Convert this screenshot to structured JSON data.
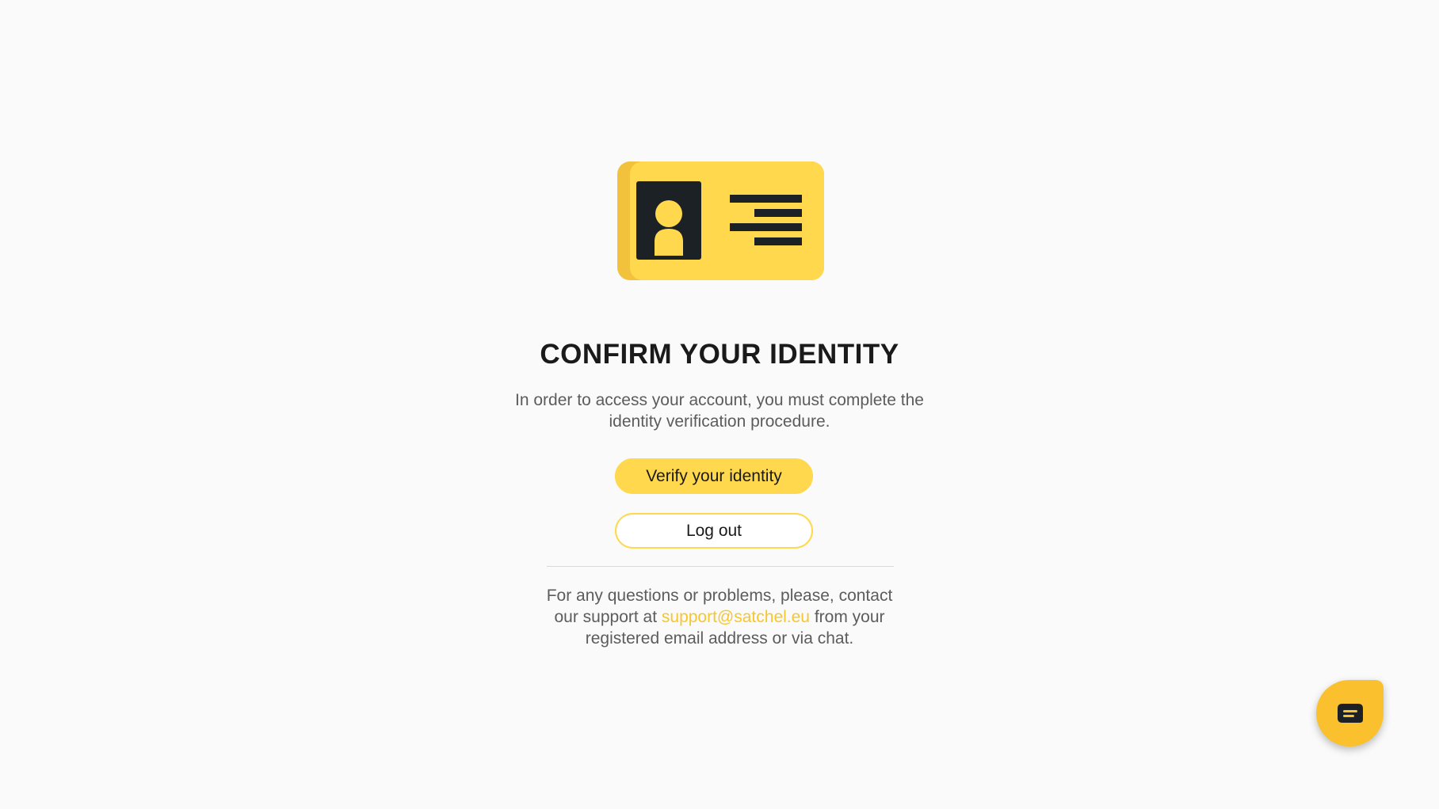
{
  "illustration": {
    "icon": "id-card-icon",
    "colors": {
      "card": "#ffd84d",
      "card_edge": "#f2c23c",
      "dark": "#1b2125"
    }
  },
  "main": {
    "title": "CONFIRM YOUR IDENTITY",
    "description": "In order to access your account, you must complete the identity verification procedure.",
    "verify_button_label": "Verify your identity",
    "logout_button_label": "Log out"
  },
  "support": {
    "text_before": "For any questions or problems, please, contact our support at ",
    "email": "support@satchel.eu",
    "text_after": " from your registered email address or via chat."
  },
  "chat": {
    "icon": "chat-bubble-icon"
  },
  "colors": {
    "accent": "#ffd84d",
    "link": "#f7c62f",
    "chat_button": "#fbc02d",
    "background": "#fafafa"
  }
}
